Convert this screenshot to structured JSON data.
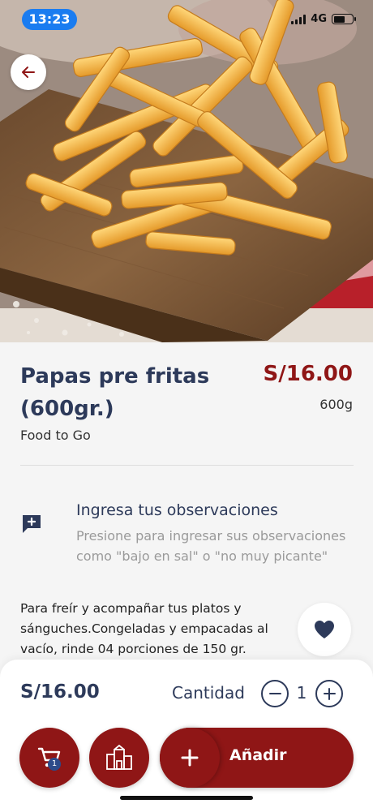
{
  "status_bar": {
    "time": "13:23",
    "network": "4G"
  },
  "product": {
    "name": "Papas pre fritas (600gr.)",
    "price": "S/16.00",
    "weight": "600g",
    "brand": "Food to Go",
    "description": "Para freír y acompañar tus platos y sánguches.Congeladas y empacadas al vacío, rinde 04 porciones de 150 gr."
  },
  "observations": {
    "title": "Ingresa tus observaciones",
    "hint": "Presione para ingresar sus observaciones como \"bajo en sal\" o \"no muy picante\""
  },
  "cart_bar": {
    "total": "S/16.00",
    "quantity_label": "Cantidad",
    "quantity": "1",
    "cart_badge": "1",
    "add_label": "Añadir"
  },
  "colors": {
    "brand_red": "#8f1616",
    "navy": "#2d3a5a",
    "status_blue": "#1a7cf0"
  },
  "icons": [
    "back-arrow-icon",
    "chat-add-icon",
    "heart-icon",
    "cart-icon",
    "store-icon",
    "plus-icon",
    "minus-icon"
  ]
}
